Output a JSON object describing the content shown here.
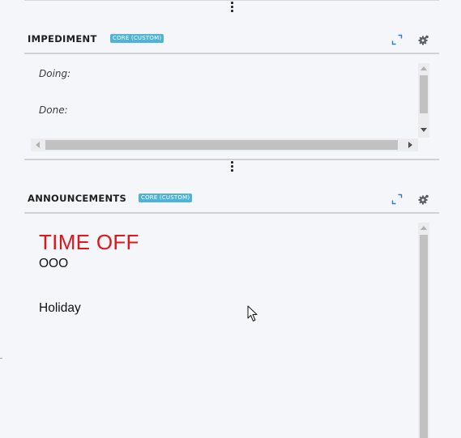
{
  "impediment_widget": {
    "title": "IMPEDIMENT",
    "badge": "CORE (CUSTOM)",
    "fields": [
      {
        "label": "Doing:"
      },
      {
        "label": "Done:"
      }
    ],
    "icons": [
      "expand-icon",
      "settings-gear-icon",
      "more-options-icon"
    ]
  },
  "announcements_widget": {
    "title": "ANNOUNCEMENTS",
    "badge": "CORE (CUSTOM)",
    "heading": "TIME OFF",
    "heading_color": "#e0161b",
    "lines": [
      "OOO",
      "Holiday"
    ],
    "icons": [
      "expand-icon",
      "settings-gear-icon",
      "more-options-icon"
    ]
  },
  "colors": {
    "background": "#f5f6fa",
    "badge": "#4fb3d4",
    "accent_link": "#2b7cd3"
  }
}
